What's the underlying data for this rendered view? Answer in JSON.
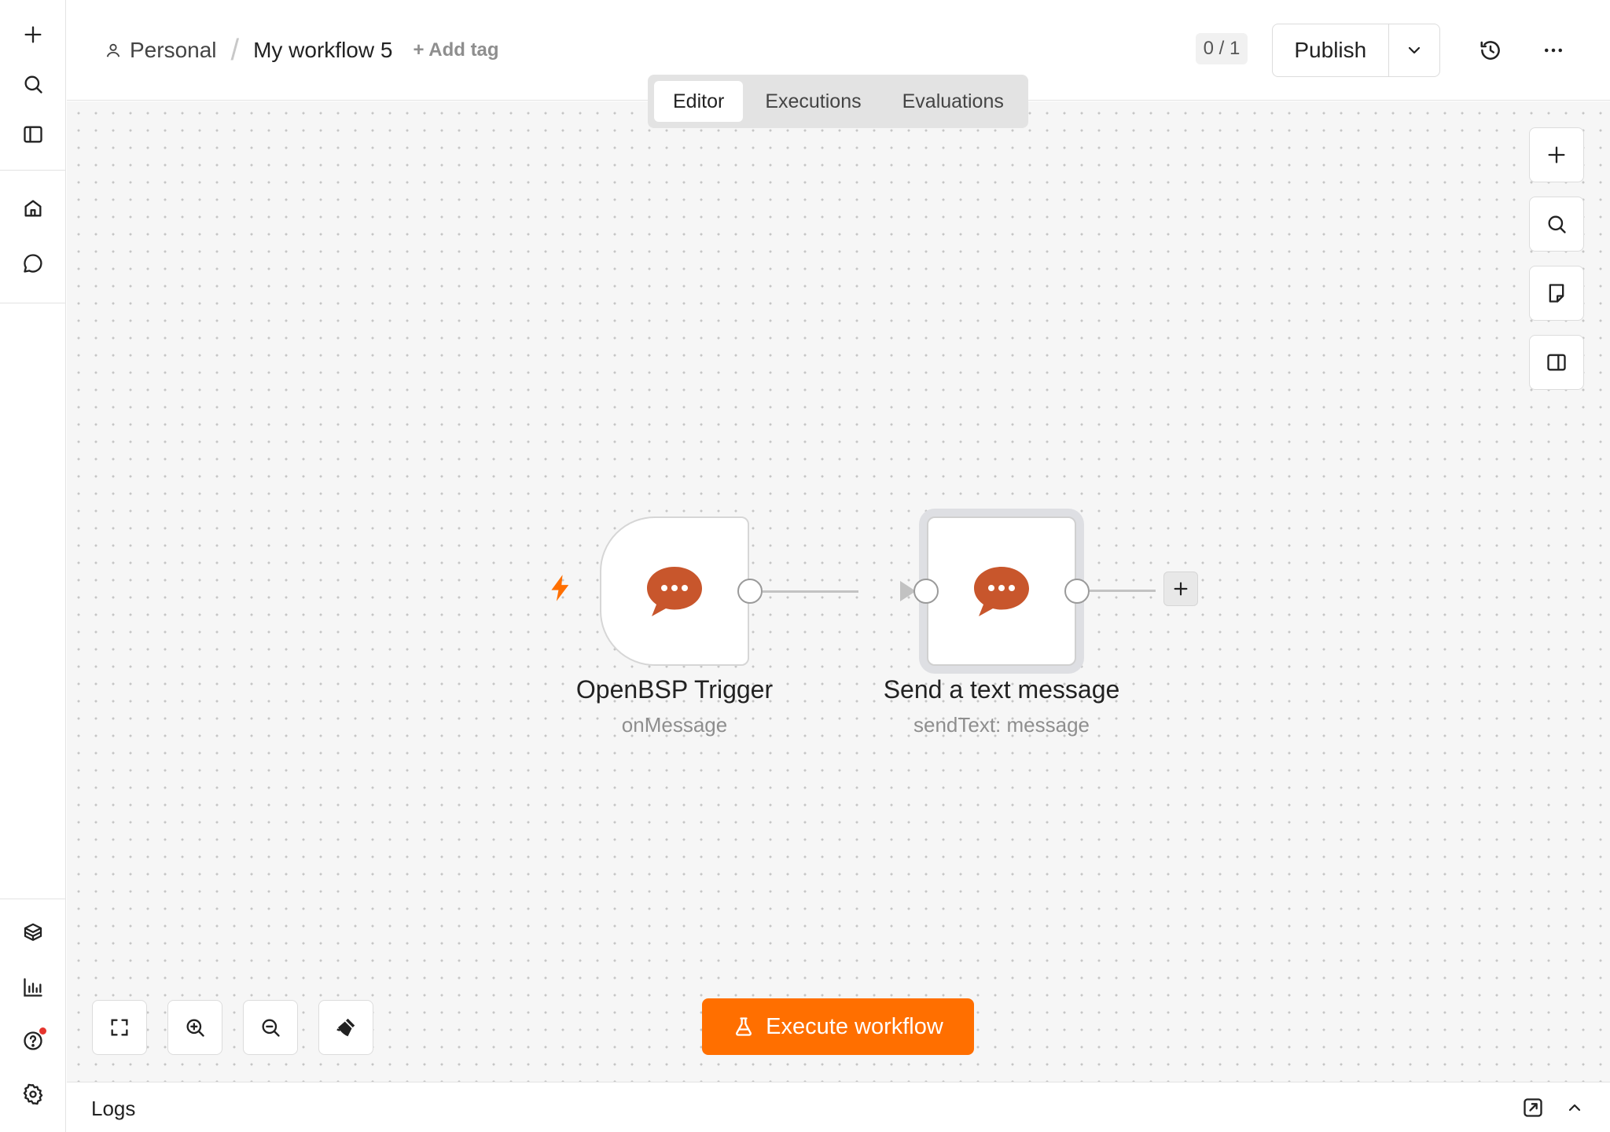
{
  "sidebar": {
    "top": [
      {
        "name": "create-button",
        "icon": "plus-icon"
      },
      {
        "name": "search-button",
        "icon": "search-icon"
      },
      {
        "name": "toggle-sidebar-button",
        "icon": "sidebar-panel-icon"
      }
    ],
    "nav": [
      {
        "name": "home-button",
        "icon": "home-icon"
      },
      {
        "name": "chat-button",
        "icon": "chat-bubble-icon"
      }
    ],
    "bottom": [
      {
        "name": "templates-button",
        "icon": "box-icon"
      },
      {
        "name": "insights-button",
        "icon": "bar-chart-icon"
      },
      {
        "name": "help-button",
        "icon": "help-circle-icon",
        "notification": true
      },
      {
        "name": "settings-button",
        "icon": "gear-icon"
      }
    ]
  },
  "header": {
    "project": "Personal",
    "separator": "/",
    "workflow_name": "My workflow 5",
    "add_tag": "+ Add tag",
    "counter": "0 / 1",
    "publish_label": "Publish"
  },
  "tabs": [
    {
      "label": "Editor",
      "active": true
    },
    {
      "label": "Executions",
      "active": false
    },
    {
      "label": "Evaluations",
      "active": false
    }
  ],
  "nodes": [
    {
      "label": "OpenBSP Trigger",
      "subtitle": "onMessage",
      "type": "trigger",
      "icon": "chat-bubble-dots-icon"
    },
    {
      "label": "Send a text message",
      "subtitle": "sendText: message",
      "type": "action",
      "icon": "chat-bubble-dots-icon"
    }
  ],
  "canvas": {
    "execute_label": "Execute workflow",
    "accent_color": "#ff6f00",
    "node_icon_color": "#c8562c"
  },
  "logs": {
    "label": "Logs"
  }
}
